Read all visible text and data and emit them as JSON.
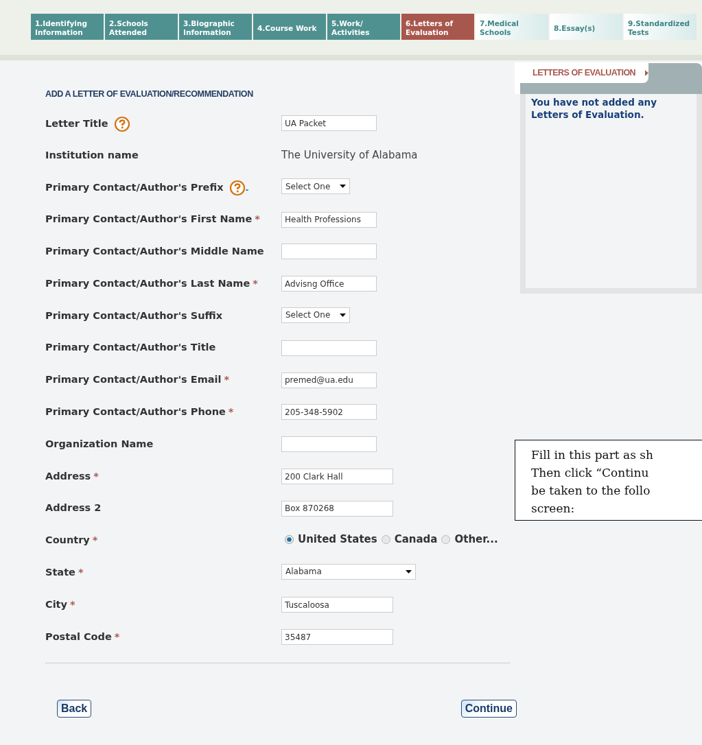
{
  "tabs": [
    {
      "label": "1.Identifying Information",
      "selected": false,
      "completed": true
    },
    {
      "label": "2.Schools Attended",
      "selected": false,
      "completed": true
    },
    {
      "label": "3.Biographic Information",
      "selected": false,
      "completed": true
    },
    {
      "label": "4.Course Work",
      "selected": false,
      "completed": true
    },
    {
      "label": "5.Work/ Activities",
      "selected": false,
      "completed": true
    },
    {
      "label": "6.Letters of Evaluation",
      "selected": true
    },
    {
      "label": "7.Medical Schools",
      "selected": false,
      "completed": false
    },
    {
      "label": "8.Essay(s)",
      "selected": false,
      "completed": false
    },
    {
      "label": "9.Standardized Tests",
      "selected": false,
      "completed": false
    }
  ],
  "form": {
    "heading": "ADD A LETTER OF EVALUATION/RECOMMENDATION",
    "fields": [
      {
        "label": "Letter Title",
        "kind": "text",
        "value": "UA Packet",
        "help": true
      },
      {
        "label": "Institution name",
        "kind": "static",
        "value": "The University of Alabama"
      },
      {
        "label": "Primary Contact/Author's Prefix",
        "kind": "select",
        "value": "Select One",
        "help": true,
        "note": "-"
      },
      {
        "label": "Primary Contact/Author's First Name",
        "kind": "text",
        "value": "Health Professions",
        "required_mark": "*"
      },
      {
        "label": "Primary Contact/Author's Middle Name",
        "kind": "text"
      },
      {
        "label": "Primary Contact/Author's Last Name",
        "kind": "text",
        "value": "Advisng Office",
        "required_mark": "*"
      },
      {
        "label": "Primary Contact/Author's Suffix",
        "kind": "select",
        "value": "Select One"
      },
      {
        "label": "Primary Contact/Author's Title",
        "kind": "text"
      },
      {
        "label": "Primary Contact/Author's Email",
        "kind": "text",
        "value": "premed@ua.edu",
        "required_mark": "*"
      },
      {
        "label": "Primary Contact/Author's Phone",
        "kind": "text",
        "value": "205-348-5902",
        "required_mark": "*"
      },
      {
        "label": "Organization Name",
        "kind": "text"
      },
      {
        "label": "Address",
        "kind": "text",
        "value": "200 Clark Hall",
        "required_mark": "*",
        "wide": true
      },
      {
        "label": "Address 2",
        "kind": "text",
        "value": "Box 870268",
        "wide": true
      },
      {
        "label": "Country",
        "kind": "radio",
        "required_mark": "*",
        "options": [
          {
            "label": "United States",
            "selected": true
          },
          {
            "label": "Canada",
            "selected": false
          },
          {
            "label": "Other...",
            "selected": false
          }
        ]
      },
      {
        "label": "State",
        "kind": "select",
        "value": "Alabama",
        "required_mark": "*",
        "wide": true
      },
      {
        "label": "City",
        "kind": "text",
        "value": "Tuscaloosa",
        "required_mark": "*",
        "wide": true
      },
      {
        "label": "Postal Code",
        "kind": "text",
        "value": "35487",
        "required_mark": "*",
        "wide": true
      }
    ],
    "buttons": [
      "Back",
      "Continue"
    ]
  },
  "side_panel": {
    "title": "LETTERS OF EVALUATION",
    "message": "You have not added any Letters of Evaluation."
  },
  "callout": {
    "lines": [
      "Fill in this part as sh",
      "Then click “Continu",
      "be taken to the follo",
      "screen:"
    ]
  }
}
